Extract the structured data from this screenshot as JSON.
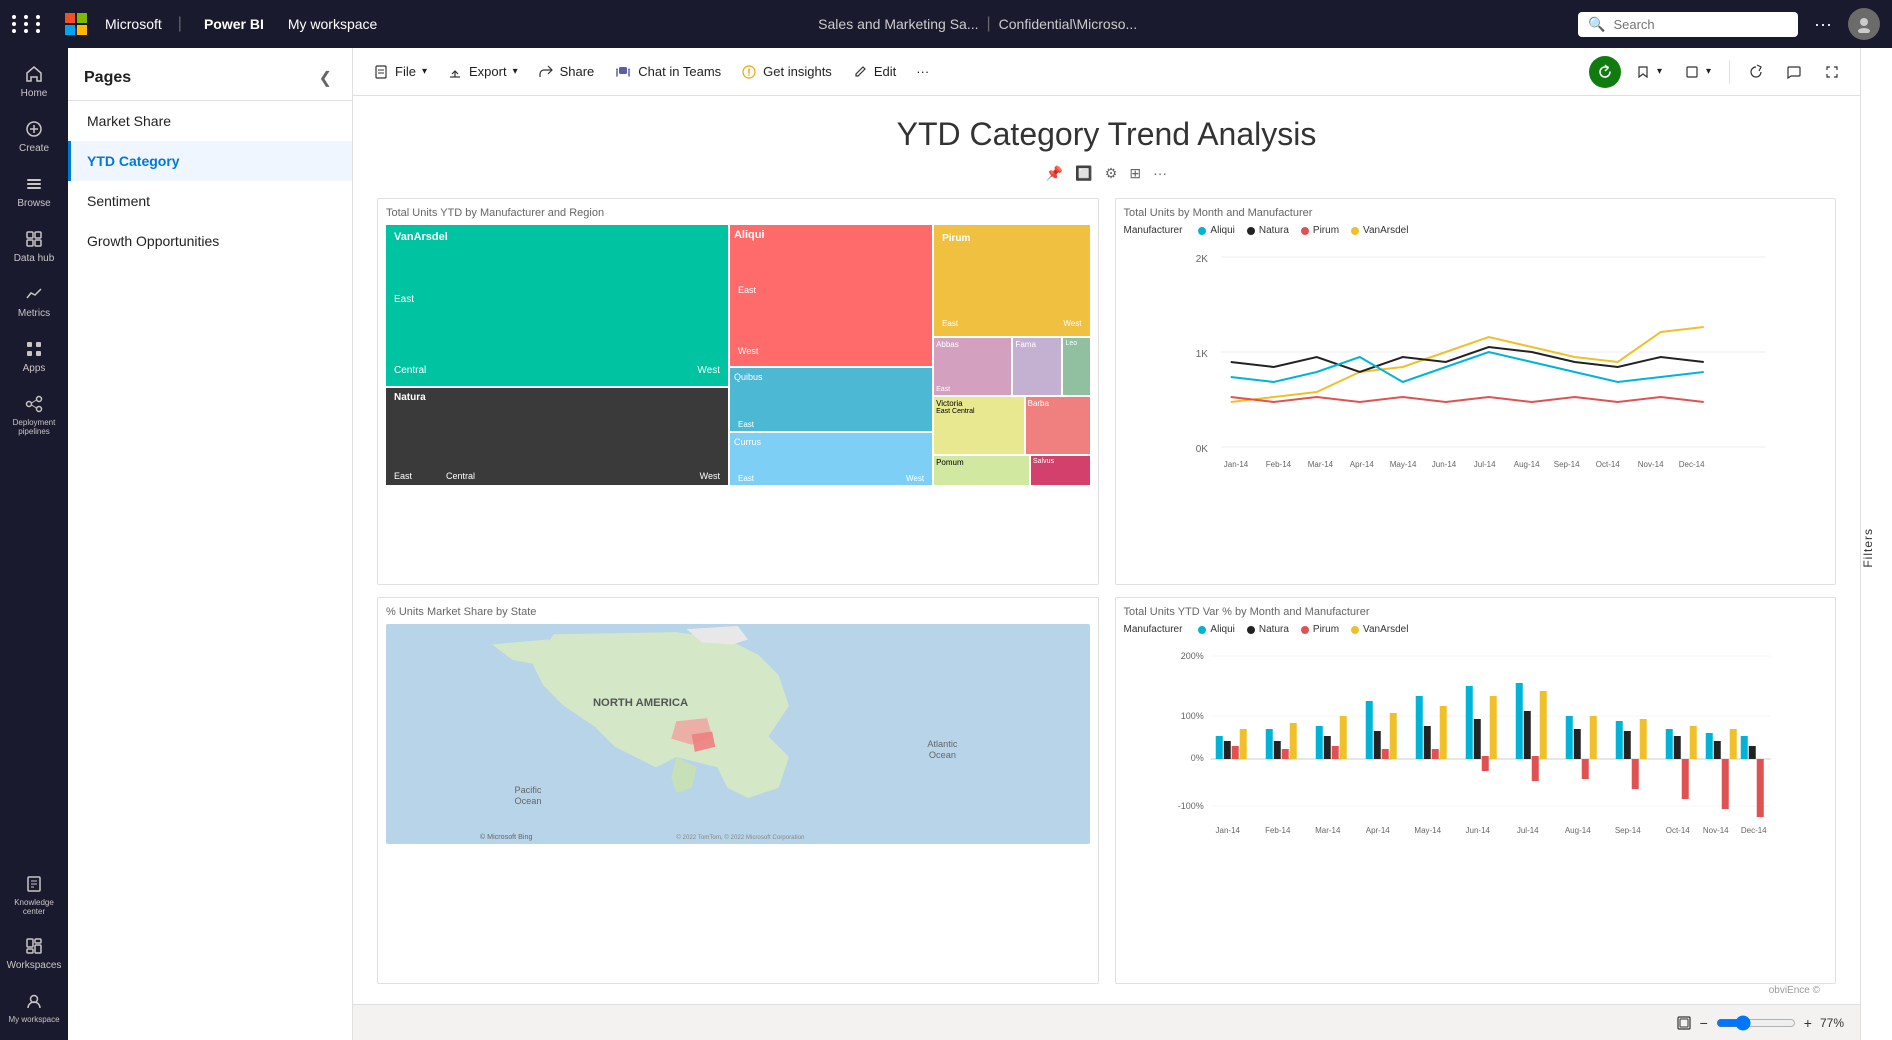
{
  "app": {
    "grid_icon": "⋮⋮⋮",
    "brand": "Microsoft",
    "product": "Power BI",
    "workspace": "My workspace",
    "report_name": "Sales and Marketing Sa...",
    "sensitivity": "Confidential\\Microso...",
    "search_placeholder": "Search",
    "more_icon": "···",
    "avatar_initials": ""
  },
  "nav": {
    "items": [
      {
        "id": "home",
        "label": "Home",
        "icon": "🏠"
      },
      {
        "id": "create",
        "label": "Create",
        "icon": "➕"
      },
      {
        "id": "browse",
        "label": "Browse",
        "icon": "☰"
      },
      {
        "id": "data-hub",
        "label": "Data hub",
        "icon": "🗄"
      },
      {
        "id": "metrics",
        "label": "Metrics",
        "icon": "📊"
      },
      {
        "id": "apps",
        "label": "Apps",
        "icon": "⊞"
      },
      {
        "id": "deployment",
        "label": "Deployment pipelines",
        "icon": "🔀"
      },
      {
        "id": "knowledge",
        "label": "Knowledge center",
        "icon": "📚"
      },
      {
        "id": "workspaces",
        "label": "Workspaces",
        "icon": "🗂"
      },
      {
        "id": "my-workspace",
        "label": "My workspace",
        "icon": "👤"
      }
    ]
  },
  "pages": {
    "title": "Pages",
    "collapse_icon": "❮",
    "items": [
      {
        "id": "market-share",
        "label": "Market Share",
        "active": false
      },
      {
        "id": "ytd-category",
        "label": "YTD Category",
        "active": true
      },
      {
        "id": "sentiment",
        "label": "Sentiment",
        "active": false
      },
      {
        "id": "growth-opportunities",
        "label": "Growth Opportunities",
        "active": false
      }
    ]
  },
  "toolbar": {
    "file_label": "File",
    "export_label": "Export",
    "share_label": "Share",
    "chat_label": "Chat in Teams",
    "insights_label": "Get insights",
    "edit_label": "Edit",
    "more_icon": "···",
    "filters_label": "Filters"
  },
  "report": {
    "title": "YTD Category Trend Analysis",
    "chart1_title": "Total Units YTD by Manufacturer and Region",
    "chart2_title": "Total Units by Month and Manufacturer",
    "chart3_title": "% Units Market Share by State",
    "chart4_title": "Total Units YTD Var % by Month and Manufacturer",
    "legend_manufacturers": [
      "Aliqui",
      "Natura",
      "Pirum",
      "VanArsdel"
    ],
    "legend_colors": [
      "#00b4d8",
      "#222",
      "#e05252",
      "#f0c02a"
    ],
    "y_axis_labels_line": [
      "2K",
      "1K",
      "0K"
    ],
    "x_axis_labels": [
      "Jan-14",
      "Feb-14",
      "Mar-14",
      "Apr-14",
      "May-14",
      "Jun-14",
      "Jul-14",
      "Aug-14",
      "Sep-14",
      "Oct-14",
      "Nov-14",
      "Dec-14"
    ],
    "y_axis_bar": [
      "200%",
      "100%",
      "0%",
      "-100%"
    ],
    "map_labels": [
      "NORTH AMERICA",
      "Pacific\nOcean",
      "Atlantic\nOcean"
    ],
    "credit": "obviEnce ©",
    "map_credit": "© Microsoft Bing",
    "map_credit2": "© 2022 TomTom, © 2022 Microsoft Corporation",
    "zoom_level": "77%"
  },
  "bottom_bar": {
    "zoom_out": "−",
    "zoom_in": "+",
    "fit_icon": "⊡"
  }
}
